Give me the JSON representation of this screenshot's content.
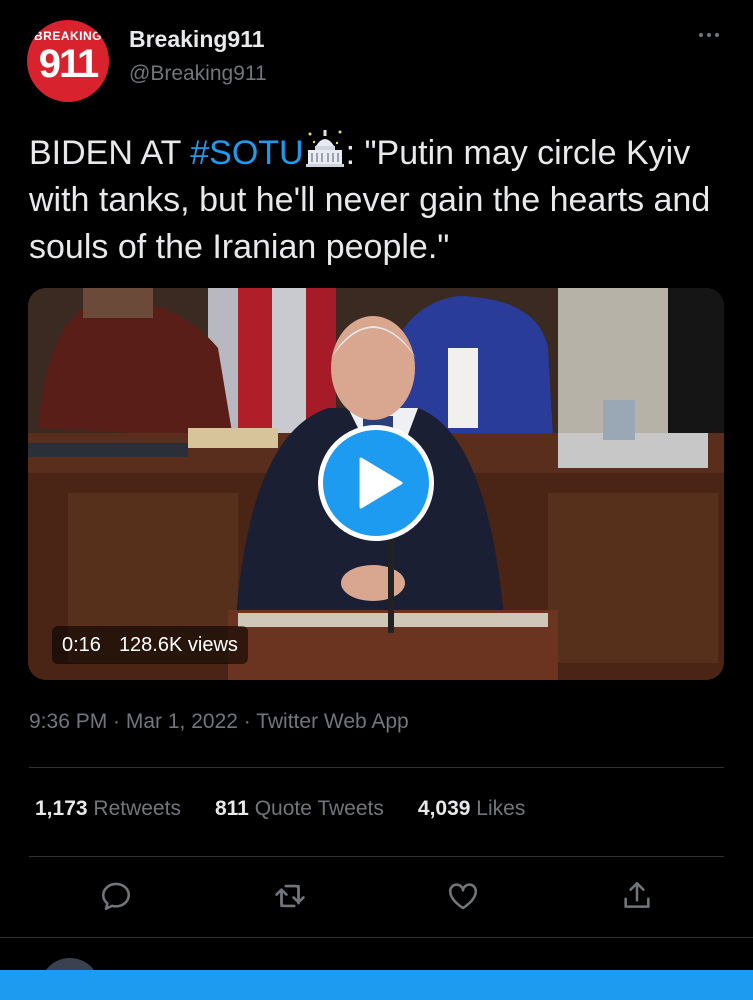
{
  "account": {
    "avatar_top": "BREAKING",
    "avatar_num": "911",
    "name": "Breaking911",
    "handle": "@Breaking911"
  },
  "tweet": {
    "text_pre": "BIDEN AT ",
    "hashtag": "#SOTU",
    "text_post": ": \"Putin may circle Kyiv with tanks, but he'll never gain the hearts and souls of the Iranian people.\""
  },
  "video": {
    "duration": "0:16",
    "views": "128.6K views"
  },
  "meta": "9:36 PM · Mar 1, 2022 · Twitter Web App",
  "stats": {
    "retweets_count": "1,173",
    "retweets_label": "Retweets",
    "quotes_count": "811",
    "quotes_label": "Quote Tweets",
    "likes_count": "4,039",
    "likes_label": "Likes"
  },
  "icons": {
    "reply": "reply-icon",
    "retweet": "retweet-icon",
    "like": "heart-icon",
    "share": "share-icon",
    "more": "more-icon",
    "play": "play-icon",
    "capitol": "capitol-emoji"
  },
  "colors": {
    "accent": "#1d9bf0",
    "background": "#000000",
    "secondary_text": "#71767b",
    "brand_red": "#d8222e"
  }
}
